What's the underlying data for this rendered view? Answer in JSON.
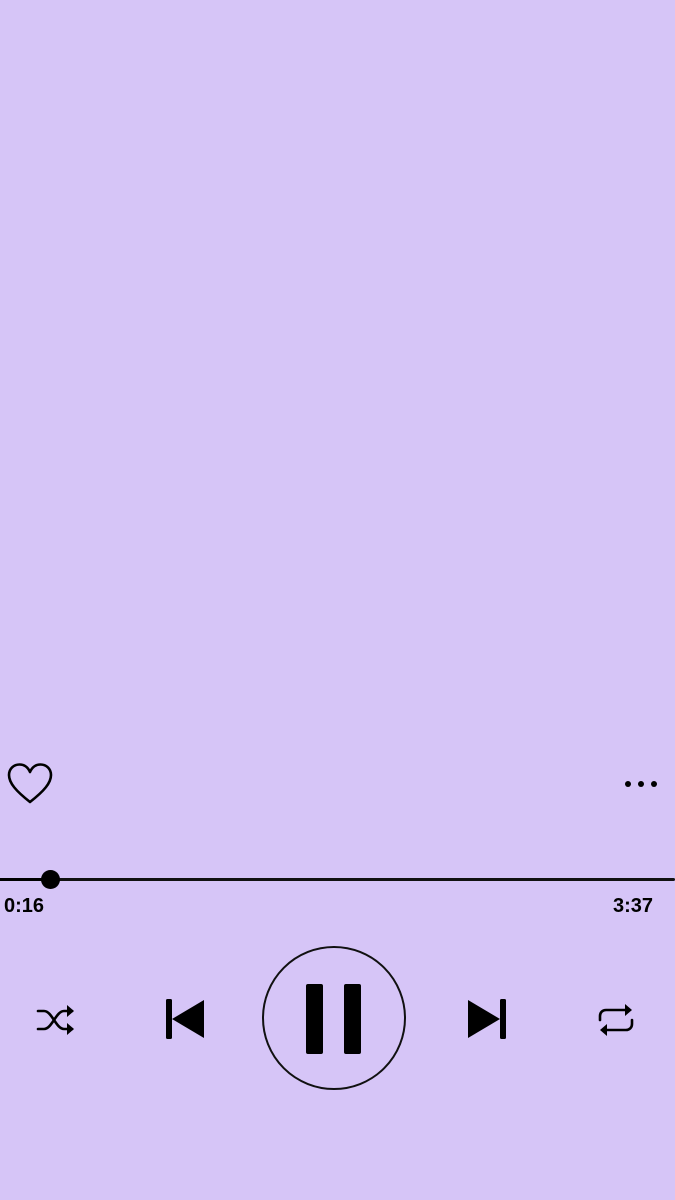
{
  "colors": {
    "background": "#d6c5f7",
    "foreground": "#000000"
  },
  "player": {
    "favorite_icon": "heart-outline-icon",
    "more_icon": "more-horizontal-icon",
    "elapsed": "0:16",
    "duration": "3:37",
    "progress_fraction": 0.074,
    "is_playing": true,
    "controls": {
      "shuffle_icon": "shuffle-icon",
      "previous_icon": "skip-previous-icon",
      "play_pause_icon": "pause-icon",
      "next_icon": "skip-next-icon",
      "repeat_icon": "repeat-icon"
    }
  }
}
